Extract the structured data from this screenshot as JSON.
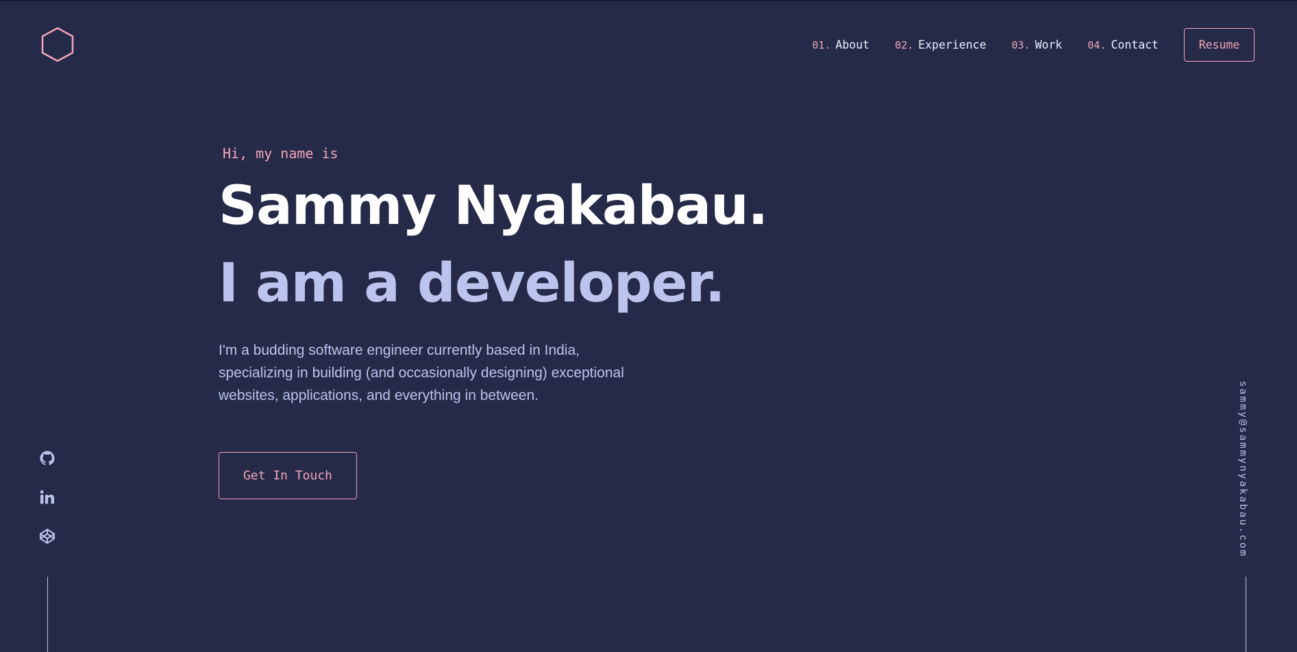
{
  "colors": {
    "background": "#252a48",
    "accent": "#f4a6b8",
    "heading": "#ffffff",
    "muted": "#bcc4ee"
  },
  "logo": {
    "icon": "hexagon-icon"
  },
  "nav": {
    "items": [
      {
        "num": "01.",
        "label": "About"
      },
      {
        "num": "02.",
        "label": "Experience"
      },
      {
        "num": "03.",
        "label": "Work"
      },
      {
        "num": "04.",
        "label": "Contact"
      }
    ],
    "resume_label": "Resume"
  },
  "hero": {
    "greeting": "Hi, my name is",
    "name": "Sammy Nyakabau.",
    "tagline": "I am a developer.",
    "bio": "I'm a budding software engineer currently based in India, specializing in building (and occasionally designing) exceptional websites, applications, and everything in between.",
    "cta_label": "Get In Touch"
  },
  "social": {
    "icons": [
      "github-icon",
      "linkedin-icon",
      "codepen-icon"
    ]
  },
  "email": "sammy@sammynyakabau.com"
}
